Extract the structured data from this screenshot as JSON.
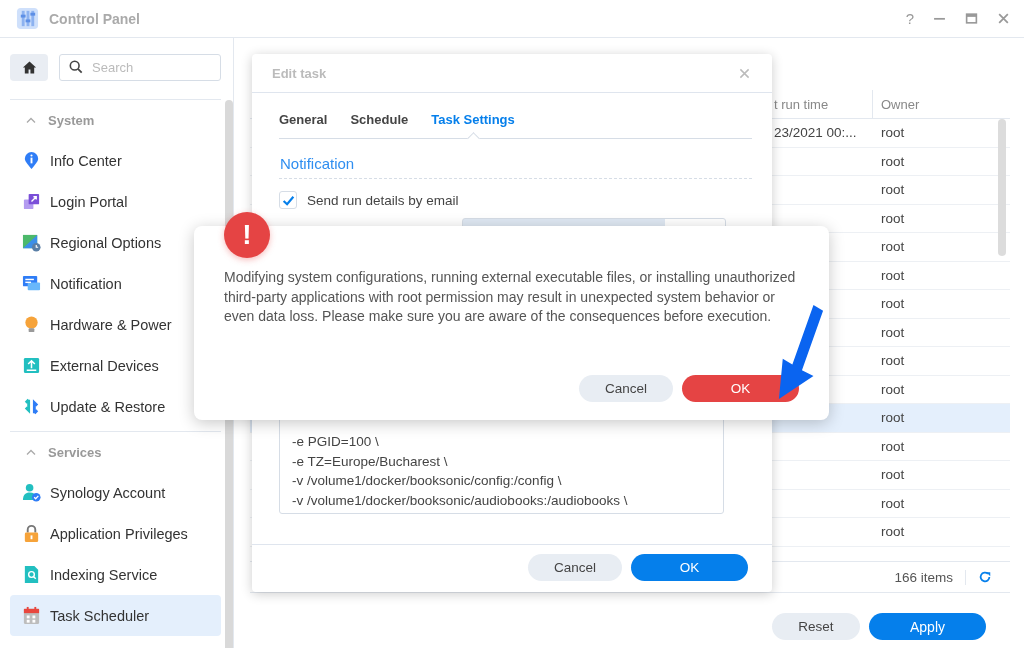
{
  "window": {
    "title": "Control Panel",
    "help": "?"
  },
  "sidebar": {
    "search": {
      "placeholder": "Search"
    },
    "sections": [
      {
        "title": "System",
        "expanded": true,
        "items": [
          {
            "label": "Info Center",
            "selected": false
          },
          {
            "label": "Login Portal",
            "selected": false
          },
          {
            "label": "Regional Options",
            "selected": false
          },
          {
            "label": "Notification",
            "selected": false
          },
          {
            "label": "Hardware & Power",
            "selected": false
          },
          {
            "label": "External Devices",
            "selected": false
          },
          {
            "label": "Update & Restore",
            "selected": false
          }
        ]
      },
      {
        "title": "Services",
        "expanded": true,
        "items": [
          {
            "label": "Synology Account",
            "selected": false
          },
          {
            "label": "Application Privileges",
            "selected": false
          },
          {
            "label": "Indexing Service",
            "selected": false
          },
          {
            "label": "Task Scheduler",
            "selected": true
          }
        ]
      }
    ]
  },
  "table": {
    "columns": [
      "t run time",
      "Owner"
    ],
    "rows": [
      {
        "column_1": "23/2021 00:...",
        "owner": "root",
        "selected": false
      },
      {
        "owner": "root",
        "selected": false
      },
      {
        "owner": "root",
        "selected": false
      },
      {
        "owner": "root",
        "selected": false
      },
      {
        "owner": "root",
        "selected": false
      },
      {
        "owner": "root",
        "selected": false
      },
      {
        "owner": "root",
        "selected": false
      },
      {
        "owner": "root",
        "selected": false
      },
      {
        "owner": "root",
        "selected": false
      },
      {
        "owner": "root",
        "selected": false
      },
      {
        "owner": "root",
        "selected": true
      },
      {
        "owner": "root",
        "selected": false
      },
      {
        "owner": "root",
        "selected": false
      },
      {
        "owner": "root",
        "selected": false
      },
      {
        "owner": "root",
        "selected": false
      }
    ],
    "count": "166 items"
  },
  "buttons": [
    "Reset",
    "Apply"
  ],
  "edit_dialog": {
    "title": "Edit task",
    "tabs": [
      {
        "label": "General",
        "selected": false
      },
      {
        "label": "Schedule",
        "selected": false
      },
      {
        "label": "Task Settings",
        "selected": true
      }
    ],
    "section": "Notification",
    "checkbox": {
      "label": "Send run details by email",
      "checked": true
    },
    "script_lines": [
      "-e PGID=100 \\",
      "-e TZ=Europe/Bucharest \\",
      "-v /volume1/docker/booksonic/config:/config \\",
      "-v /volume1/docker/booksonic/audiobooks:/audiobooks \\"
    ],
    "buttons": [
      {
        "label": "Cancel",
        "kind": "secondary"
      },
      {
        "label": "OK",
        "kind": "primary"
      }
    ]
  },
  "warning_dialog": {
    "badge": "!",
    "text": "Modifying system configurations, running external executable files, or installing unauthorized third-party applications with root permission may result in unexpected system behavior or even data loss. Please make sure you are aware of the consequences before execution.",
    "buttons": [
      {
        "label": "Cancel",
        "kind": "secondary"
      },
      {
        "label": "OK",
        "kind": "danger"
      }
    ]
  }
}
